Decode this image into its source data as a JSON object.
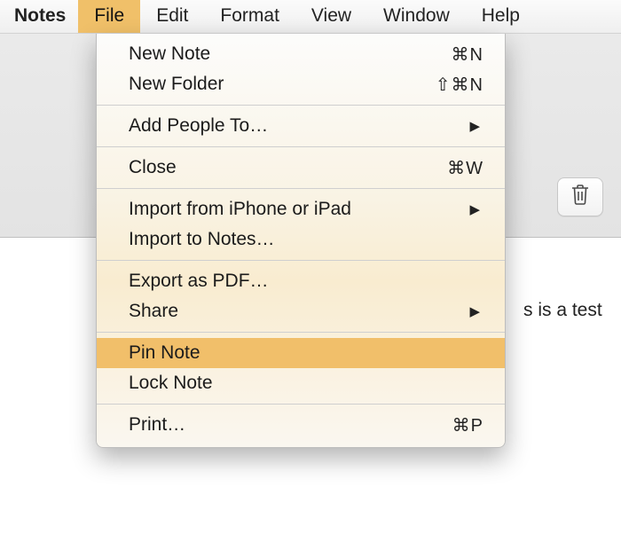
{
  "menubar": {
    "app_name": "Notes",
    "items": [
      {
        "label": "File",
        "open": true
      },
      {
        "label": "Edit",
        "open": false
      },
      {
        "label": "Format",
        "open": false
      },
      {
        "label": "View",
        "open": false
      },
      {
        "label": "Window",
        "open": false
      },
      {
        "label": "Help",
        "open": false
      }
    ]
  },
  "dropdown": {
    "items": [
      {
        "label": "New Note",
        "shortcut": "⌘N"
      },
      {
        "label": "New Folder",
        "shortcut": "⇧⌘N"
      },
      {
        "separator": true
      },
      {
        "label": "Add People To…",
        "submenu": true
      },
      {
        "separator": true
      },
      {
        "label": "Close",
        "shortcut": "⌘W"
      },
      {
        "separator": true
      },
      {
        "label": "Import from iPhone or iPad",
        "submenu": true
      },
      {
        "label": "Import to Notes…"
      },
      {
        "separator": true
      },
      {
        "label": "Export as PDF…"
      },
      {
        "label": "Share",
        "submenu": true
      },
      {
        "separator": true
      },
      {
        "label": "Pin Note",
        "highlight": true
      },
      {
        "label": "Lock Note"
      },
      {
        "separator": true
      },
      {
        "label": "Print…",
        "shortcut": "⌘P"
      }
    ]
  },
  "note": {
    "visible_text": "s is a test"
  },
  "toolbar": {
    "trash_label": "Delete"
  }
}
